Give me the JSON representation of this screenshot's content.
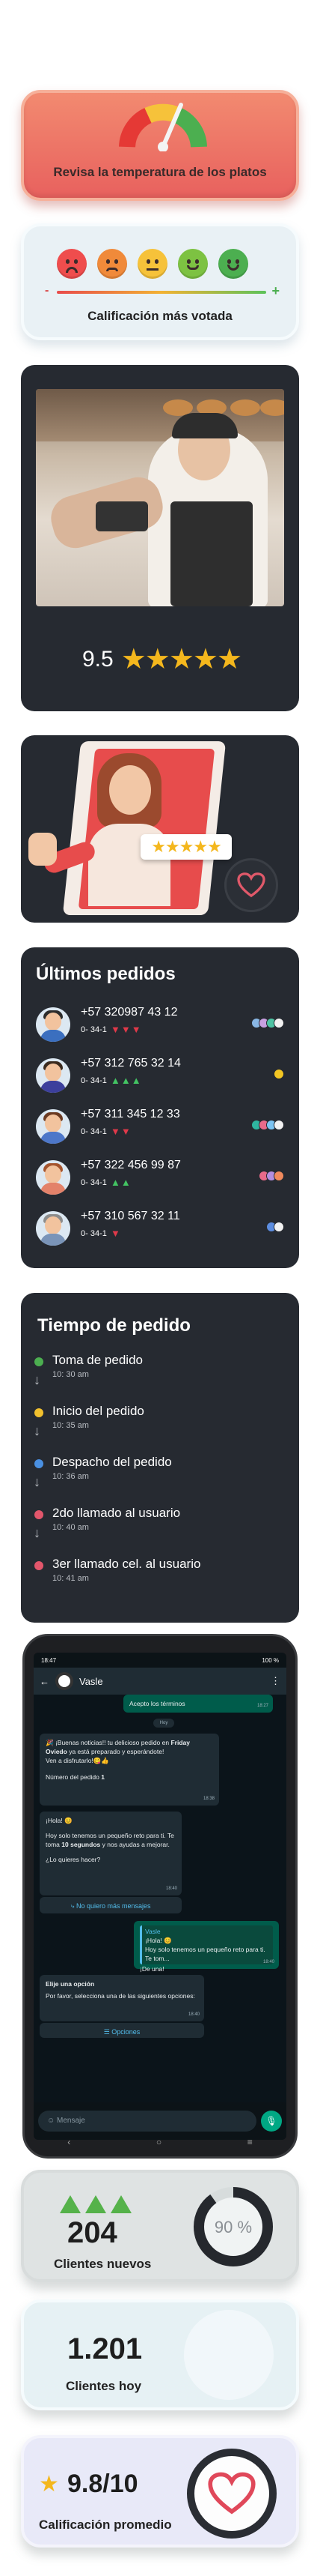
{
  "gauge": {
    "label": "Revisa la temperatura de los platos"
  },
  "ratings": {
    "label": "Calificación más votada",
    "min_symbol": "-",
    "max_symbol": "+"
  },
  "photo_card": {
    "score": "9.5",
    "stars": "★★★★★"
  },
  "illustration": {
    "stars": "★★★★★"
  },
  "orders": {
    "title": "Últimos pedidos",
    "items": [
      {
        "phone": "+57 320987 43 12",
        "code": "0- 34-1",
        "trend": "down",
        "arrows": "▼▼▼",
        "avatar_hair": "#2c2c2c",
        "avatar_body": "#3b6fbf",
        "chips": [
          "#89b7e5",
          "#c7a0e0",
          "#4ec3a3",
          "#f2f2f2"
        ]
      },
      {
        "phone": "+57 312 765 32 14",
        "code": "0- 34-1",
        "trend": "up",
        "arrows": "▲▲▲",
        "avatar_hair": "#3a2a1e",
        "avatar_body": "#3c3f9c",
        "chips": [
          "#f3c623"
        ]
      },
      {
        "phone": "+57  311 345 12 33",
        "code": "0- 34-1",
        "trend": "down",
        "arrows": "▼▼",
        "avatar_hair": "#6a3a22",
        "avatar_body": "#4d77c9",
        "chips": [
          "#2fb5a0",
          "#e86a8a",
          "#7cc4f2",
          "#f2f2f2"
        ]
      },
      {
        "phone": "+57 322 456 99 87",
        "code": "0- 34-1",
        "trend": "up",
        "arrows": "▲▲",
        "avatar_hair": "#a4542d",
        "avatar_body": "#e3826a",
        "chips": [
          "#e86a8a",
          "#b38ee0",
          "#f08a5d"
        ]
      },
      {
        "phone": "+57 310 567 32 11",
        "code": "0- 34-1",
        "trend": "down",
        "arrows": "▼",
        "avatar_hair": "#8c8c8c",
        "avatar_body": "#7a94b8",
        "chips": [
          "#5c8de0",
          "#f2f2f2"
        ]
      }
    ]
  },
  "timeline": {
    "title": "Tiempo de pedido",
    "items": [
      {
        "title": "Toma de pedido",
        "time": "10: 30 am",
        "color": "#4caf50"
      },
      {
        "title": "Inicio del pedido",
        "time": "10: 35 am",
        "color": "#f2c12e"
      },
      {
        "title": "Despacho del pedido",
        "time": "10: 36 am",
        "color": "#4a90e2"
      },
      {
        "title": "2do llamado al usuario",
        "time": "10: 40 am",
        "color": "#e2566b"
      },
      {
        "title": "3er llamado cel. al usuario",
        "time": "10: 41 am",
        "color": "#e2566b"
      }
    ]
  },
  "phone": {
    "status_time": "18:47",
    "battery": "100 %",
    "contact": "Vasle",
    "msg_accept": "Acepto los términos",
    "msg_accept_time": "18:27",
    "day_pill": "Hoy",
    "msg_ready_line1": "🎉 ¡Buenas noticias!! tu delicioso pedido en",
    "msg_ready_brand": "Friday Oviedo",
    "msg_ready_line2": "ya está preparado y esperándote!",
    "msg_ready_line3": "Ven a disfrutarlo!😋👍",
    "msg_order_label": "Número del pedido",
    "msg_order_number": "1",
    "msg_ready_time": "18:38",
    "msg_hi": "¡Hola! 😊",
    "msg_challenge_1": "Hoy solo tenemos un pequeño reto para ti. Te toma",
    "msg_challenge_secs": "10 segundos",
    "msg_challenge_2": "y nos ayudas a mejorar.",
    "msg_question": "¿Lo quieres hacer?",
    "msg_question_time": "18:40",
    "msg_decline": "No quiero más mensajes",
    "reply_quote_name": "Vasle",
    "reply_quote_hi": "¡Hola! 😊",
    "reply_quote_text": "Hoy solo tenemos un pequeño reto para ti. Te tom...",
    "reply_text": "¡De una!",
    "reply_time": "18:40",
    "options_title": "Elije una opción",
    "options_text": "Por favor, selecciona una de las siguientes opciones:",
    "options_time": "18:40",
    "options_button": "Opciones",
    "composer_placeholder": "Mensaje"
  },
  "clients_new": {
    "value": "204",
    "label": "Clientes nuevos",
    "percent_text": "90 %",
    "percent": 90
  },
  "clients_today": {
    "value": "1.201",
    "label": "Clientes hoy"
  },
  "avg_rating": {
    "value": "9.8/10",
    "label": "Calificación promedio",
    "star": "★"
  }
}
